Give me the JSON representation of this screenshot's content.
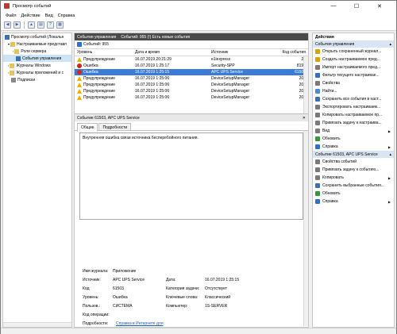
{
  "window": {
    "title": "Просмотр событий",
    "minimize": "—",
    "maximize": "☐",
    "close": "✕"
  },
  "menu": [
    "Файл",
    "Действие",
    "Вид",
    "Справка"
  ],
  "tree": {
    "items": [
      {
        "label": "Просмотр событий (Локальн",
        "indent": 0,
        "icon": "event-viewer-icon"
      },
      {
        "label": "Настраиваемые представл",
        "indent": 1,
        "icon": "folder-icon"
      },
      {
        "label": "Роли сервера",
        "indent": 2,
        "icon": "folder-icon"
      },
      {
        "label": "События управления",
        "indent": 2,
        "icon": "filter-icon",
        "selected": true
      },
      {
        "label": "Журналы Windows",
        "indent": 1,
        "icon": "folder-icon"
      },
      {
        "label": "Журналы приложений и с",
        "indent": 1,
        "icon": "folder-icon"
      },
      {
        "label": "Подписки",
        "indent": 1,
        "icon": "subscriptions-icon"
      }
    ]
  },
  "center": {
    "header": "События управления",
    "header_count": "Событий: 955 (!) Есть новые события",
    "filter_text": "Событий: 955",
    "columns": [
      "Уровень",
      "Дата и время",
      "Источник",
      "Код события"
    ],
    "rows": [
      {
        "level": "Предупреждение",
        "type": "warn",
        "date": "16.07.2019 20:21:29",
        "source": "e1iexpress",
        "code": "27"
      },
      {
        "level": "Ошибка",
        "type": "err",
        "date": "16.07.2019 1:25:17",
        "source": "Security-SPP",
        "code": "8198"
      },
      {
        "level": "Ошибка",
        "type": "err",
        "date": "16.07.2019 1:25:15",
        "source": "APC UPS Service",
        "code": "61503",
        "selected": true
      },
      {
        "level": "Предупреждение",
        "type": "warn",
        "date": "16.07.2019 1:25:06",
        "source": "DeviceSetupManager",
        "code": "200"
      },
      {
        "level": "Предупреждение",
        "type": "warn",
        "date": "16.07.2019 1:25:06",
        "source": "DeviceSetupManager",
        "code": "202"
      },
      {
        "level": "Предупреждение",
        "type": "warn",
        "date": "16.07.2019 1:25:06",
        "source": "DeviceSetupManager",
        "code": "200"
      },
      {
        "level": "Предупреждение",
        "type": "warn",
        "date": "16.07.2019 1:25:06",
        "source": "DeviceSetupManager",
        "code": "200"
      }
    ],
    "detail_title": "Событие 61503, APC UPS Service",
    "tabs": [
      "Общие",
      "Подробности"
    ],
    "message": "Внутренняя ошибка связи источника бесперебойного питания.",
    "props": {
      "log_label": "Имя журнала:",
      "log_value": "Приложение",
      "source_label": "Источник:",
      "source_value": "APC UPS Service",
      "date_label": "Дата:",
      "date_value": "16.07.2019 1:25:15",
      "code_label": "Код",
      "code_value": "61503",
      "task_label": "Категория задачи:",
      "task_value": "Отсутствует",
      "level_label": "Уровень:",
      "level_value": "Ошибка",
      "keywords_label": "Ключевые слова:",
      "keywords_value": "Классический",
      "user_label": "Пользов.:",
      "user_value": "СИСТЕМА",
      "computer_label": "Компьютер:",
      "computer_value": "1S-SERVER",
      "opcode_label": "Код операции:",
      "more_label": "Подробности:",
      "more_link": "Справка в Интернете для"
    }
  },
  "actions": {
    "title": "Действия",
    "section1": "События управления",
    "items1": [
      {
        "label": "Открыть сохраненный журнал...",
        "icon": "open-log-icon",
        "color": "#d9a400"
      },
      {
        "label": "Создать настраиваемое пред...",
        "icon": "create-view-icon",
        "color": "#d9a400"
      },
      {
        "label": "Импорт настраиваемого пред...",
        "icon": "import-icon",
        "color": "#7a7a7a"
      },
      {
        "label": "Фильтр текущего настраивае...",
        "icon": "filter-icon",
        "color": "#2f6fd0"
      },
      {
        "label": "Свойства",
        "icon": "properties-icon",
        "color": "#7a7a7a"
      },
      {
        "label": "Найти...",
        "icon": "find-icon",
        "color": "#4a8bd6"
      },
      {
        "label": "Сохранить все события в наст...",
        "icon": "save-icon",
        "color": "#3a6fb0"
      },
      {
        "label": "Экспортировать настраиваем...",
        "icon": "export-icon",
        "color": "#7a7a7a"
      },
      {
        "label": "Копировать настраиваемое пр...",
        "icon": "copy-icon",
        "color": "#7a7a7a"
      },
      {
        "label": "Привязать задачу к настраива...",
        "icon": "attach-task-icon",
        "color": "#7a7a7a"
      },
      {
        "label": "Вид",
        "icon": "view-icon",
        "color": "#7a7a7a",
        "arrow": true
      },
      {
        "label": "Обновить",
        "icon": "refresh-icon",
        "color": "#2e9a3a"
      },
      {
        "label": "Справка",
        "icon": "help-icon",
        "color": "#2f6fd0",
        "arrow": true
      }
    ],
    "section2": "Событие 61503, APC UPS Service",
    "items2": [
      {
        "label": "Свойства событий",
        "icon": "event-properties-icon",
        "color": "#7a7a7a"
      },
      {
        "label": "Привязать задачу к событию...",
        "icon": "attach-task-icon",
        "color": "#7a7a7a"
      },
      {
        "label": "Копировать",
        "icon": "copy-icon",
        "color": "#7a7a7a",
        "arrow": true
      },
      {
        "label": "Сохранить выбранные события...",
        "icon": "save-icon",
        "color": "#3a6fb0"
      },
      {
        "label": "Обновить",
        "icon": "refresh-icon",
        "color": "#2e9a3a"
      },
      {
        "label": "Справка",
        "icon": "help-icon",
        "color": "#2f6fd0",
        "arrow": true
      }
    ]
  }
}
